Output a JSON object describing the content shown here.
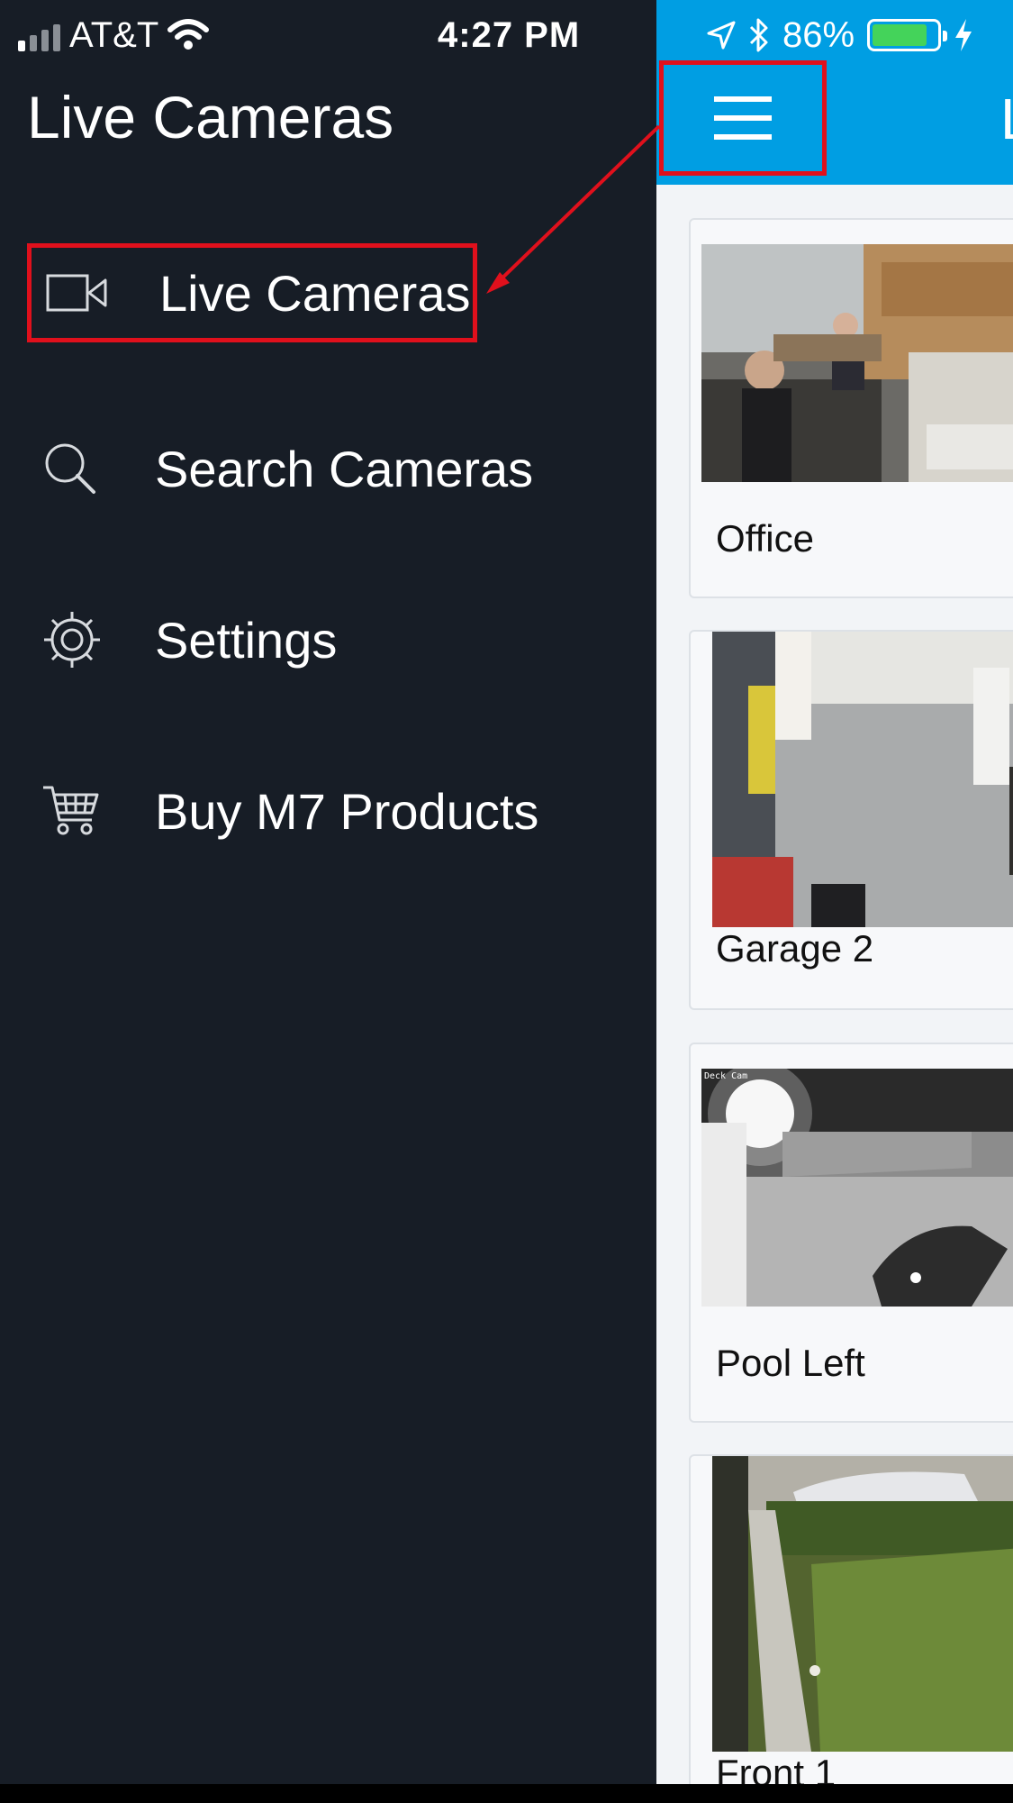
{
  "status_bar": {
    "carrier": "AT&T",
    "time": "4:27 PM",
    "battery_percent": "86%",
    "battery_level": 0.86
  },
  "drawer": {
    "title": "Live Cameras",
    "items": [
      {
        "label": "Live Cameras",
        "icon": "video-camera-icon",
        "active": true
      },
      {
        "label": "Search Cameras",
        "icon": "search-icon",
        "active": false
      },
      {
        "label": "Settings",
        "icon": "gear-icon",
        "active": false
      },
      {
        "label": "Buy M7 Products",
        "icon": "cart-icon",
        "active": false
      }
    ]
  },
  "main": {
    "title_fragment": "L",
    "cameras": [
      {
        "label": "Office"
      },
      {
        "label": "Garage 2"
      },
      {
        "label": "Pool Left",
        "overlay": "Deck Cam"
      },
      {
        "label": "Front 1"
      }
    ]
  },
  "colors": {
    "drawer_bg": "#171d26",
    "appbar_blue": "#009ee3",
    "highlight_red": "#e0101c",
    "battery_green": "#44d35a"
  }
}
